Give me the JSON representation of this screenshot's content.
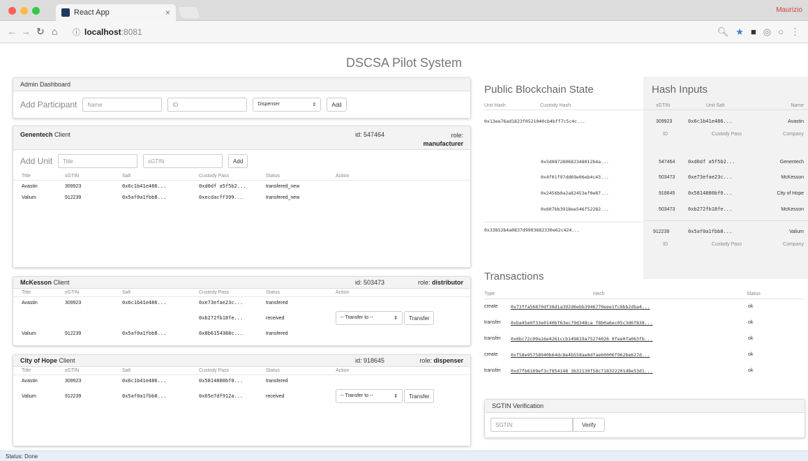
{
  "browser": {
    "tab_title": "React App",
    "tab_close": "×",
    "user": "Maurizio",
    "url_host": "localhost",
    "url_port": ":8081"
  },
  "app_title": "DSCSA Pilot System",
  "admin": {
    "title": "Admin Dashboard",
    "add_label": "Add Participant",
    "name_ph": "Name",
    "id_ph": "ID",
    "role_value": "Dispenser",
    "add_btn": "Add"
  },
  "clients": [
    {
      "name": "Genentech",
      "suffix": " Client",
      "id": "id: 547464",
      "role_label": "role:",
      "role": "manufacturer",
      "add_label": "Add Unit",
      "title_ph": "Title",
      "sgtin_ph": "sGTIN",
      "add_btn": "Add",
      "headers": [
        "Title",
        "sGTIN",
        "Salt",
        "Custody Pass",
        "Status",
        "Action"
      ],
      "rows": [
        {
          "title": "Avastin",
          "sgtin": "309923",
          "salt": "0x6c1b41e486...",
          "custody": "0xd0df a5f5b2...",
          "status": "transfered_new",
          "action": false
        },
        {
          "title": "Valium",
          "sgtin": "912239",
          "salt": "0x5af0a1fbb8...",
          "custody": "0xecdacff399...",
          "status": "transfered_new",
          "action": false
        }
      ]
    },
    {
      "name": "McKesson",
      "suffix": " Client",
      "id": "id: 503473",
      "role_label": "role:",
      "role": "distributor",
      "headers": [
        "Title",
        "sGTIN",
        "Salt",
        "Custody Pass",
        "Status",
        "Action"
      ],
      "rows": [
        {
          "title": "Avastin",
          "sgtin": "309923",
          "salt": "0x6c1b41e486...",
          "custody": "0xe73efae23c...",
          "status": "transfered",
          "action": false
        },
        {
          "title": "",
          "sgtin": "",
          "salt": "",
          "custody": "0xb272fb18fe...",
          "status": "received",
          "action": true
        },
        {
          "title": "Valium",
          "sgtin": "912239",
          "salt": "0x5af0a1fbb8...",
          "custody": "0x8b6154388c...",
          "status": "transfered",
          "action": false
        }
      ]
    },
    {
      "name": "City of Hope",
      "suffix": " Client",
      "id": "id: 918645",
      "role_label": "role:",
      "role": "dispenser",
      "headers": [
        "Title",
        "sGTIN",
        "Salt",
        "Custody Pass",
        "Status",
        "Action"
      ],
      "rows": [
        {
          "title": "Avastin",
          "sgtin": "309923",
          "salt": "0x6c1b41e486...",
          "custody": "0x5814880bf0...",
          "status": "transfered",
          "action": false
        },
        {
          "title": "Valium",
          "sgtin": "912239",
          "salt": "0x5af0a1fbb8...",
          "custody": "0x65e7df912a...",
          "status": "received",
          "action": true
        }
      ]
    }
  ],
  "transfer": {
    "select": "-- Transfer to --",
    "btn": "Transfer"
  },
  "blockchain": {
    "title": "Public Blockchain State",
    "col_unit": "Unit Hash",
    "col_custody": "Custody Hash",
    "unit_hashes": [
      "0x13ee76ad1823f0521040cb4bff7c5c4c...",
      "0x33852b4a0837d9903682330e62c424..."
    ],
    "custody_hashes": [
      "0x5d087280682348012b4a...",
      "0x4f01f97dd69e06eb4c43...",
      "0x2456b0a2a82453ef0e87...",
      "0x607bb3918ee546f52282..."
    ]
  },
  "hash_inputs": {
    "title": "Hash Inputs",
    "group1": {
      "h1": [
        "sGTIN",
        "Unit Salt",
        "Name"
      ],
      "v1": [
        "309923",
        "0x6c1b41e486...",
        "Avastin"
      ],
      "h2": [
        "ID",
        "Custody Pass",
        "Company"
      ],
      "rows": [
        [
          "547464",
          "0xd0df a5f5b2...",
          "Genentech"
        ],
        [
          "503473",
          "0xe73efae23c...",
          "McKesson"
        ],
        [
          "918645",
          "0x5814880bf0...",
          "City of Hope"
        ],
        [
          "503473",
          "0xb272fb18fe...",
          "McKesson"
        ]
      ]
    },
    "group2": {
      "v1": [
        "912239",
        "0x5af0a1fbb8...",
        "Valium"
      ],
      "h2": [
        "ID",
        "Custody Pass",
        "Company"
      ]
    }
  },
  "transactions": {
    "title": "Transactions",
    "headers": [
      "Type",
      "Hash",
      "Status"
    ],
    "rows": [
      {
        "type": "create",
        "hash": "0x73ffa56870df38d1a392d6ebb3946770eee1fc8bb2dba4...",
        "status": "ok"
      },
      {
        "type": "transfer",
        "hash": "0xba45e0f33e0140bf63ec79d348ca f8b0a6ec05c3d6f838...",
        "status": "ok"
      },
      {
        "type": "transfer",
        "hash": "0x6bc72c09a16e4261ccb149819a75274026 0fee0fa063fb...",
        "status": "ok"
      },
      {
        "type": "create",
        "hash": "0xf58e95758940b64dc8e4b558ae8dfae60006f962be627d...",
        "status": "ok"
      },
      {
        "type": "transfer",
        "hash": "0xd7fb6169ef3cf854148 3b32130f58c718322201d8e53d1...",
        "status": "ok"
      }
    ]
  },
  "verify": {
    "title": "SGTIN Verification",
    "placeholder": "SGTIN",
    "btn": "Verify"
  },
  "status": "Status: Done"
}
